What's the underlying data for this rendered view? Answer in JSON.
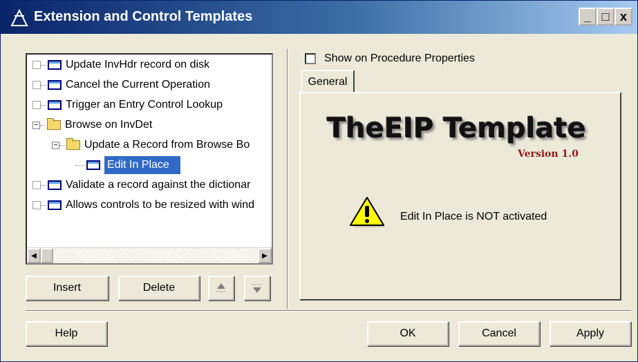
{
  "window": {
    "title": "Extension and Control Templates",
    "controls": {
      "minimize": "_",
      "maximize": "□",
      "close": "x"
    }
  },
  "tree": {
    "items": [
      {
        "label": "Update InvHdr record on disk",
        "icon": "procedure-icon"
      },
      {
        "label": "Cancel the Current Operation",
        "icon": "procedure-icon"
      },
      {
        "label": "Trigger an Entry Control Lookup",
        "icon": "procedure-icon"
      },
      {
        "label": "Browse on InvDet",
        "icon": "folder-icon",
        "expanded": true
      },
      {
        "label": "Update a Record from Browse Bo",
        "icon": "folder-icon",
        "expanded": true
      },
      {
        "label": "Edit In Place",
        "icon": "procedure-icon",
        "selected": true
      },
      {
        "label": "Validate a record against the dictionar",
        "icon": "procedure-icon"
      },
      {
        "label": "Allows controls to be resized with wind",
        "icon": "procedure-icon"
      }
    ]
  },
  "buttons": {
    "insert": "Insert",
    "delete": "Delete",
    "help": "Help",
    "ok": "OK",
    "cancel": "Cancel",
    "apply": "Apply"
  },
  "options": {
    "show_on_procedure_properties": "Show on Procedure Properties",
    "checked": false
  },
  "tabs": [
    {
      "label": "General",
      "active": true
    }
  ],
  "panel": {
    "logo_text": "TheEIP Template",
    "version_text": "Version 1.0",
    "status_text": "Edit In Place is NOT activated"
  },
  "colors": {
    "selection": "#316ac5",
    "titlebar": "#0a246a",
    "version": "#8b1a1a"
  }
}
